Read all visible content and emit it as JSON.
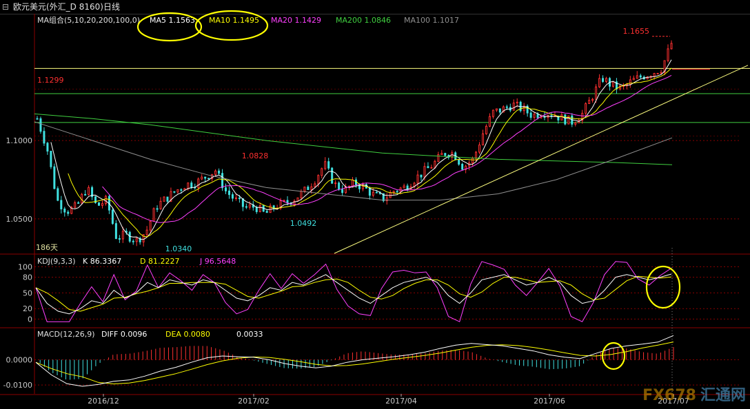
{
  "window_title": "欧元美元(外汇_D 8160)日线",
  "indicators": {
    "ma_panel": {
      "name": "MA组合(5,10,20,200,100,0)",
      "items": [
        {
          "label": "MA5",
          "value": "1.1563",
          "color": "#ffffff"
        },
        {
          "label": "MA10",
          "value": "1.1495",
          "color": "#ffff00"
        },
        {
          "label": "MA20",
          "value": "1.1429",
          "color": "#ff40ff"
        },
        {
          "label": "MA200",
          "value": "1.0846",
          "color": "#40d040"
        },
        {
          "label": "MA100",
          "value": "1.1017",
          "color": "#909090"
        }
      ]
    },
    "kdj_panel": {
      "name": "KDJ(9,3,3)",
      "items": [
        {
          "label": "K",
          "value": "86.3367",
          "color": "#ffffff"
        },
        {
          "label": "D",
          "value": "81.2227",
          "color": "#ffff00"
        },
        {
          "label": "J",
          "value": "96.5648",
          "color": "#ff40ff"
        }
      ]
    },
    "macd_panel": {
      "name": "MACD(12,26,9)",
      "items": [
        {
          "label": "DIFF",
          "value": "0.0096",
          "color": "#ffffff"
        },
        {
          "label": "DEA",
          "value": "0.0080",
          "color": "#ffff00"
        },
        {
          "label": "",
          "value": "0.0033",
          "color": "#ffffff"
        }
      ]
    }
  },
  "days_label": "186天",
  "annotations": {
    "high_1": "1.1655",
    "level_1": "1.1299",
    "peak_feb": "1.0828",
    "low_mar": "1.0492",
    "low_dec": "1.0340"
  },
  "watermark": {
    "brand": "FX678",
    "sub": "汇通网"
  },
  "colors": {
    "up": "#ff3030",
    "down": "#40e0e0",
    "grid": "#8b0000"
  },
  "chart_data": [
    {
      "type": "candlestick",
      "title": "欧元美元(外汇_D 8160)日线",
      "x_ticks": [
        "2016/12",
        "2017/02",
        "2017/04",
        "2017/06",
        "2017/07"
      ],
      "y_ticks": [
        1.1,
        1.05
      ],
      "ylim": [
        1.028,
        1.18
      ],
      "grid": true,
      "horizontal_levels": [
        1.146,
        1.1299,
        1.1115
      ],
      "close_path": [
        1.114,
        1.095,
        1.062,
        1.055,
        1.058,
        1.07,
        1.058,
        1.062,
        1.038,
        1.04,
        1.036,
        1.042,
        1.058,
        1.063,
        1.068,
        1.072,
        1.073,
        1.077,
        1.081,
        1.068,
        1.062,
        1.057,
        1.058,
        1.053,
        1.058,
        1.06,
        1.063,
        1.068,
        1.075,
        1.085,
        1.072,
        1.068,
        1.073,
        1.07,
        1.065,
        1.063,
        1.068,
        1.07,
        1.075,
        1.08,
        1.085,
        1.092,
        1.092,
        1.083,
        1.088,
        1.105,
        1.118,
        1.12,
        1.123,
        1.12,
        1.116,
        1.118,
        1.117,
        1.114,
        1.112,
        1.117,
        1.128,
        1.14,
        1.135,
        1.133,
        1.138,
        1.141,
        1.143,
        1.146,
        1.162
      ],
      "series": [
        {
          "name": "MA5",
          "color": "#ffffff"
        },
        {
          "name": "MA10",
          "color": "#ffff00"
        },
        {
          "name": "MA20",
          "color": "#ff40ff"
        },
        {
          "name": "MA200",
          "color": "#40d040",
          "values": [
            1.117,
            1.114,
            1.11,
            1.105,
            1.1,
            1.096,
            1.092,
            1.09,
            1.088,
            1.087,
            1.086,
            1.0846
          ]
        },
        {
          "name": "MA100",
          "color": "#909090",
          "values": [
            1.112,
            1.1,
            1.088,
            1.078,
            1.07,
            1.066,
            1.062,
            1.062,
            1.066,
            1.075,
            1.088,
            1.1017
          ]
        }
      ],
      "trendlines": [
        {
          "from": [
            "2017/02",
            1.028
          ],
          "to": [
            "2017/07",
            1.148
          ]
        }
      ]
    },
    {
      "type": "line",
      "title": "KDJ(9,3,3)",
      "y_ticks": [
        100,
        80,
        50,
        20,
        0
      ],
      "K_path": [
        60,
        30,
        15,
        10,
        20,
        35,
        30,
        55,
        40,
        50,
        70,
        60,
        75,
        70,
        65,
        75,
        70,
        55,
        40,
        35,
        45,
        60,
        55,
        70,
        65,
        75,
        85,
        70,
        55,
        40,
        30,
        45,
        60,
        70,
        75,
        80,
        70,
        45,
        30,
        50,
        75,
        80,
        85,
        75,
        65,
        70,
        80,
        70,
        45,
        30,
        35,
        55,
        80,
        85,
        80,
        75,
        80,
        86
      ],
      "series": [
        {
          "name": "K",
          "color": "#ffffff"
        },
        {
          "name": "D",
          "color": "#ffff00"
        },
        {
          "name": "J",
          "color": "#ff40ff"
        }
      ]
    },
    {
      "type": "bar+line",
      "title": "MACD(12,26,9)",
      "y_ticks": [
        0.0,
        -0.01
      ],
      "ylim": [
        -0.0135,
        0.0075
      ],
      "DIFF_path": [
        -0.001,
        -0.006,
        -0.0095,
        -0.0105,
        -0.0098,
        -0.0085,
        -0.008,
        -0.0065,
        -0.0045,
        -0.003,
        -0.001,
        0.0008,
        0.0015,
        0.0012,
        0.001,
        0.0,
        -0.0015,
        -0.0025,
        -0.0032,
        -0.0025,
        -0.001,
        0.0,
        0.0006,
        0.0012,
        0.002,
        0.003,
        0.0045,
        0.0058,
        0.0065,
        0.006,
        0.0055,
        0.0045,
        0.0035,
        0.002,
        0.001,
        0.0005,
        0.0025,
        0.0045,
        0.0055,
        0.0062,
        0.007,
        0.0096
      ],
      "series": [
        {
          "name": "DIFF",
          "color": "#ffffff"
        },
        {
          "name": "DEA",
          "color": "#ffff00"
        }
      ]
    }
  ]
}
